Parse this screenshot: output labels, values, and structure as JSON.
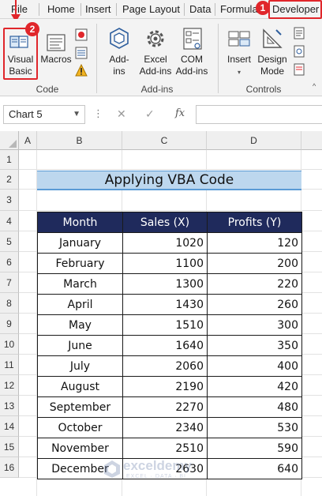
{
  "ribbon_tabs": [
    "File",
    "Home",
    "Insert",
    "Page Layout",
    "Data",
    "Formulas",
    "Developer"
  ],
  "annotations": {
    "step1": "1",
    "step2": "2"
  },
  "ribbon": {
    "code_group": {
      "label": "Code",
      "visual_basic_line1": "Visual",
      "visual_basic_line2": "Basic",
      "macros": "Macros"
    },
    "addins_group": {
      "label": "Add-ins",
      "addins_line1": "Add-",
      "addins_line2": "ins",
      "excel_addins_line1": "Excel",
      "excel_addins_line2": "Add-ins",
      "com_addins_line1": "COM",
      "com_addins_line2": "Add-ins"
    },
    "controls_group": {
      "label": "Controls",
      "insert": "Insert",
      "design_mode_line1": "Design",
      "design_mode_line2": "Mode"
    }
  },
  "formula_bar": {
    "name_box": "Chart 5",
    "cancel_glyph": "✕",
    "enter_glyph": "✓",
    "fx": "fx"
  },
  "columns": [
    "A",
    "B",
    "C",
    "D"
  ],
  "rows": [
    "1",
    "2",
    "3",
    "4",
    "5",
    "6",
    "7",
    "8",
    "9",
    "10",
    "11",
    "12",
    "13",
    "14",
    "15",
    "16"
  ],
  "sheet": {
    "title": "Applying VBA Code",
    "headers": [
      "Month",
      "Sales (X)",
      "Profits (Y)"
    ],
    "data": [
      [
        "January",
        "1020",
        "120"
      ],
      [
        "February",
        "1100",
        "200"
      ],
      [
        "March",
        "1300",
        "220"
      ],
      [
        "April",
        "1430",
        "260"
      ],
      [
        "May",
        "1510",
        "300"
      ],
      [
        "June",
        "1640",
        "350"
      ],
      [
        "July",
        "2060",
        "400"
      ],
      [
        "August",
        "2190",
        "420"
      ],
      [
        "September",
        "2270",
        "480"
      ],
      [
        "October",
        "2340",
        "530"
      ],
      [
        "November",
        "2510",
        "590"
      ],
      [
        "December",
        "2630",
        "640"
      ]
    ]
  },
  "watermark": {
    "name": "exceldemy",
    "tagline": "EXCEL · DATA · BI"
  },
  "colors": {
    "accent_red": "#e0262b",
    "table_header": "#1f2a5c",
    "title_fill": "#bdd7ee",
    "title_border": "#5b9bd5"
  }
}
